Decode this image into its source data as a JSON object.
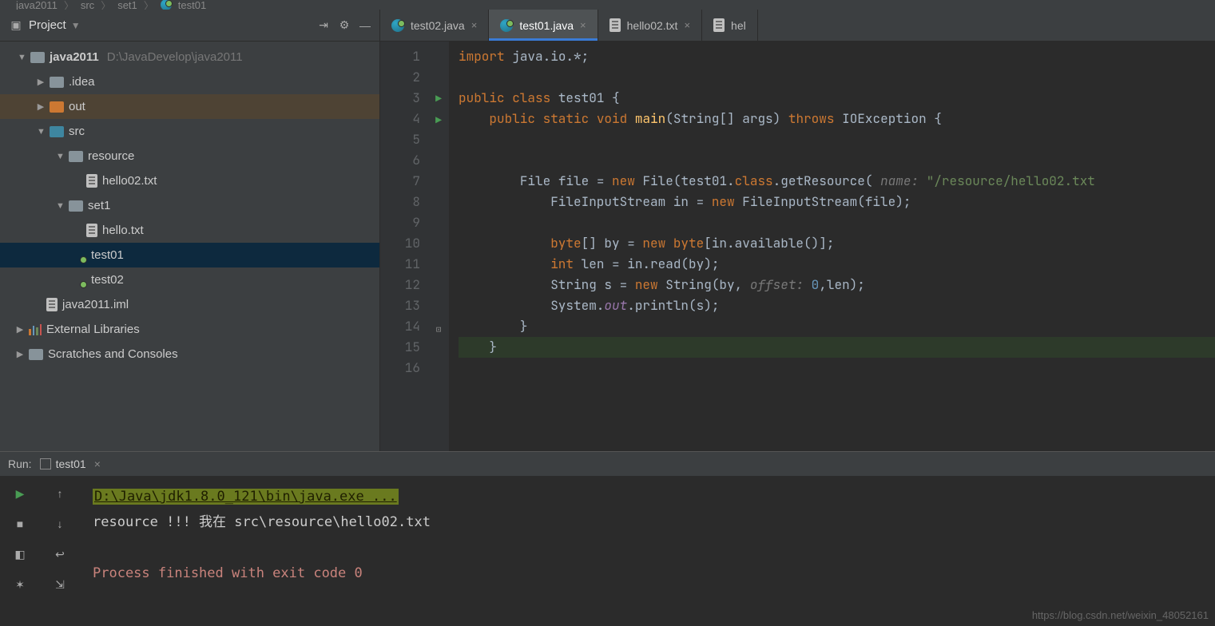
{
  "breadcrumb": {
    "parts": [
      "java2011",
      "src",
      "set1",
      "test01"
    ]
  },
  "projectHeader": {
    "title": "Project"
  },
  "tree": {
    "root": {
      "name": "java2011",
      "path": "D:\\JavaDevelop\\java2011"
    },
    "idea": {
      "name": ".idea"
    },
    "out": {
      "name": "out"
    },
    "src": {
      "name": "src"
    },
    "resource": {
      "name": "resource"
    },
    "hello02": {
      "name": "hello02.txt"
    },
    "set1": {
      "name": "set1"
    },
    "hellotxt": {
      "name": "hello.txt"
    },
    "t01": {
      "name": "test01"
    },
    "t02": {
      "name": "test02"
    },
    "iml": {
      "name": "java2011.iml"
    },
    "extlib": {
      "name": "External Libraries"
    },
    "scratch": {
      "name": "Scratches and Consoles"
    }
  },
  "tabs": [
    {
      "label": "test02.java",
      "active": false,
      "kind": "java"
    },
    {
      "label": "test01.java",
      "active": true,
      "kind": "java"
    },
    {
      "label": "hello02.txt",
      "active": false,
      "kind": "txt"
    },
    {
      "label": "hel",
      "active": false,
      "kind": "txt"
    }
  ],
  "code": {
    "lines": [
      {
        "n": 1,
        "html": "<span class='kw'>import</span> <span class='id'>java.io.*;</span>"
      },
      {
        "n": 2,
        "html": ""
      },
      {
        "n": 3,
        "run": true,
        "html": "<span class='kw'>public class</span> <span class='id'>test01 {</span>"
      },
      {
        "n": 4,
        "run": true,
        "fold": "open",
        "html": "    <span class='kw'>public static</span> <span class='kw'>void</span> <span class='fn'>main</span><span class='id'>(String[] args)</span> <span class='kw'>throws</span> <span class='id'>IOException {</span>"
      },
      {
        "n": 5,
        "html": ""
      },
      {
        "n": 6,
        "html": ""
      },
      {
        "n": 7,
        "html": "        <span class='id'>File file = </span><span class='kw'>new</span> <span class='id'>File(test01.</span><span class='kw'>class</span><span class='id'>.getResource(</span> <span class='hint'>name:</span> <span class='str'>\"/resource/hello02.txt</span>"
      },
      {
        "n": 8,
        "html": "            <span class='id'>FileInputStream in = </span><span class='kw'>new</span> <span class='id'>FileInputStream(file);</span>"
      },
      {
        "n": 9,
        "html": ""
      },
      {
        "n": 10,
        "html": "            <span class='kw'>byte</span><span class='id'>[] by = </span><span class='kw'>new byte</span><span class='id'>[in.available()];</span>"
      },
      {
        "n": 11,
        "html": "            <span class='kw'>int</span> <span class='id'>len = in.read(by);</span>"
      },
      {
        "n": 12,
        "html": "            <span class='id'>String s = </span><span class='kw'>new</span> <span class='id'>String(by,</span> <span class='hint'>offset:</span> <span class='num'>0</span><span class='id'>,len);</span>"
      },
      {
        "n": 13,
        "html": "            <span class='id'>System.</span><span class='pfield'>out</span><span class='id'>.println(s);</span>"
      },
      {
        "n": 14,
        "fold": "close",
        "html": "        <span class='id'>}</span>"
      },
      {
        "n": 15,
        "current": true,
        "html": "    <span class='id'>}</span>"
      },
      {
        "n": 16,
        "html": ""
      }
    ]
  },
  "runHeader": {
    "label": "Run:",
    "config": "test01"
  },
  "console": {
    "cmd": "D:\\Java\\jdk1.8.0_121\\bin\\java.exe ...",
    "out1": "resource  !!!    我在  src\\resource\\hello02.txt",
    "exit": "Process finished with exit code 0"
  },
  "watermark": "https://blog.csdn.net/weixin_48052161"
}
